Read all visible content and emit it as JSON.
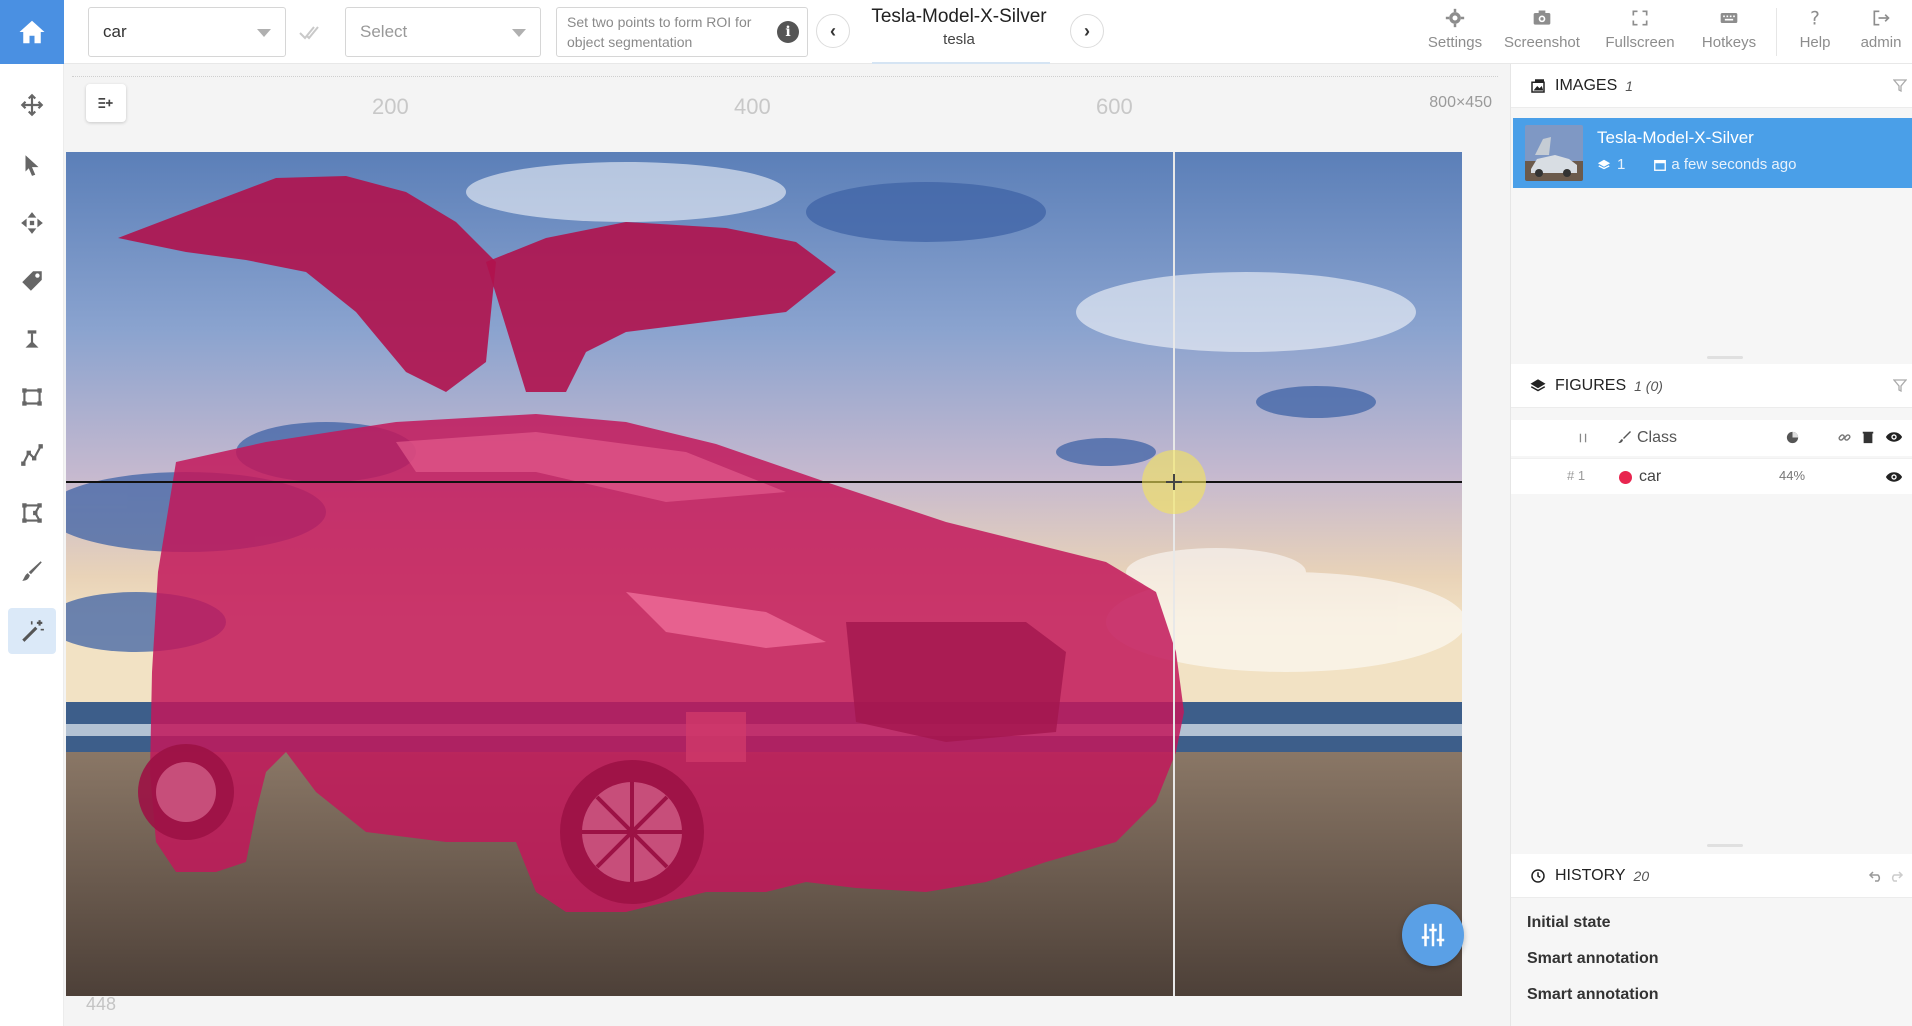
{
  "topbar": {
    "class_select_value": "car",
    "tag_select_placeholder": "Select",
    "roi_hint": "Set two points to form ROI for object segmentation",
    "image_name": "Tesla-Model-X-Silver",
    "project_name": "tesla",
    "buttons": {
      "settings": "Settings",
      "screenshot": "Screenshot",
      "fullscreen": "Fullscreen",
      "hotkeys": "Hotkeys",
      "help": "Help",
      "admin": "admin"
    }
  },
  "canvas": {
    "ruler_labels": [
      "200",
      "400",
      "600"
    ],
    "image_size": "800×450",
    "bottom_ruler_label": "448",
    "mask_color": "#c2185b"
  },
  "images_panel": {
    "title": "IMAGES",
    "count": "1",
    "items": [
      {
        "name": "Tesla-Model-X-Silver",
        "figures": "1",
        "time": "a few seconds ago"
      }
    ]
  },
  "figures_panel": {
    "title": "FIGURES",
    "count": "1 (0)",
    "columns": {
      "index": "#",
      "class": "Class"
    },
    "rows": [
      {
        "index": "# 1",
        "class": "car",
        "color": "#e8254f",
        "area": "44%"
      }
    ]
  },
  "history_panel": {
    "title": "HISTORY",
    "count": "20",
    "items": [
      "Initial state",
      "Smart annotation",
      "Smart annotation"
    ]
  },
  "colors": {
    "accent": "#4a90e2",
    "selection": "#4a9fe8"
  }
}
